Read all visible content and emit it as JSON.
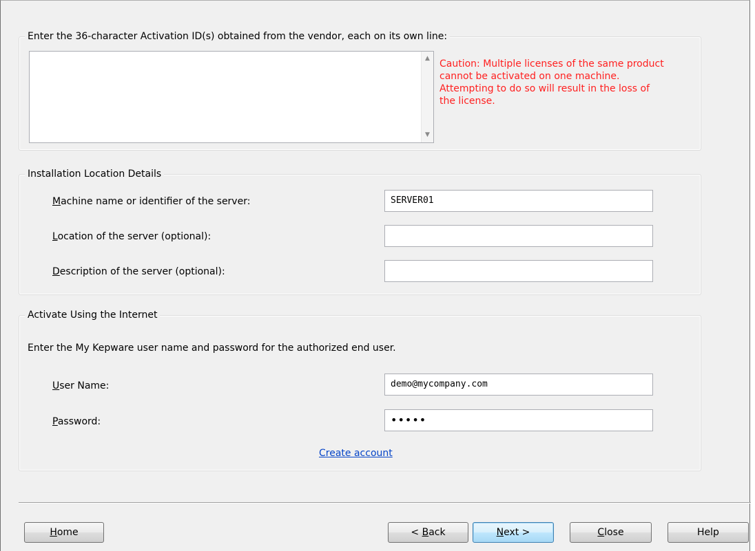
{
  "activation": {
    "group_label": "Enter the 36-character Activation ID(s) obtained from the vendor, each on its own line:",
    "textarea_value": "",
    "caution": "Caution: Multiple licenses of the same product\ncannot be activated on one machine.\nAttempting to do so will result in the loss of\nthe license.",
    "caution_color": "#ff1f1f"
  },
  "installation": {
    "group_label": "Installation Location Details",
    "machine_label": {
      "hotkey": "M",
      "rest": "achine name or identifier of the server:"
    },
    "machine_value": "SERVER01",
    "location_label": {
      "hotkey": "L",
      "rest": "ocation of the server (optional):"
    },
    "location_value": "",
    "description_label": {
      "hotkey": "D",
      "rest": "escription of the server (optional):"
    },
    "description_value": ""
  },
  "internet": {
    "group_label": "Activate Using the Internet",
    "instructions": "Enter the My Kepware user name and password for the authorized end user.",
    "username_label": {
      "hotkey": "U",
      "rest": "ser Name:"
    },
    "username_value": "demo@mycompany.com",
    "password_label": {
      "hotkey": "P",
      "rest": "assword:"
    },
    "password_value": "•••••",
    "create_account_link": "Create account",
    "link_color": "#0645c8"
  },
  "buttons": {
    "home": {
      "hotkey": "H",
      "rest": "ome"
    },
    "back": {
      "prefix": "< ",
      "hotkey": "B",
      "rest": "ack"
    },
    "next": {
      "hotkey": "N",
      "rest": "ext >"
    },
    "close": {
      "hotkey": "C",
      "rest": "lose"
    },
    "help": "Help"
  },
  "icons": {
    "scroll_up": "▲",
    "scroll_down": "▼"
  }
}
